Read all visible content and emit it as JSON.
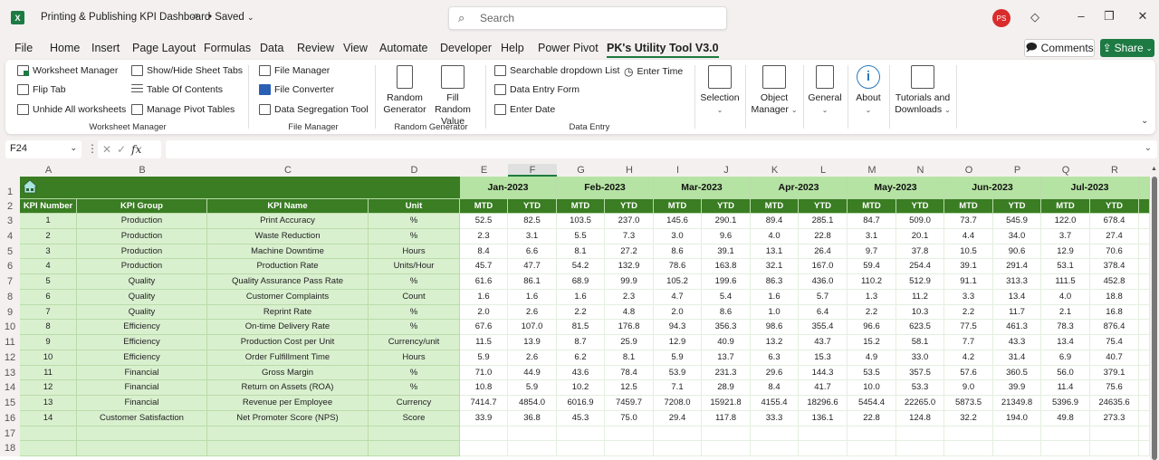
{
  "titlebar": {
    "app_icon": "excel-icon",
    "app_icon_letter": "X",
    "document_title": "Printing & Publishing KPI Dashboard",
    "save_status": "• Saved",
    "search_placeholder": "Search",
    "user_initials": "PS",
    "user_avatar_color": "#d92d2d"
  },
  "menu": {
    "tabs": [
      "File",
      "Home",
      "Insert",
      "Page Layout",
      "Formulas",
      "Data",
      "Review",
      "View",
      "Automate",
      "Developer",
      "Help",
      "Power Pivot",
      "PK's Utility Tool V3.0"
    ],
    "active_tab": "PK's Utility Tool V3.0",
    "comments_label": "Comments",
    "share_label": "Share",
    "share_color": "#1d7a43"
  },
  "ribbon": {
    "worksheet_manager": {
      "label": "Worksheet Manager",
      "items": [
        "Worksheet Manager",
        "Flip Tab",
        "Unhide All worksheets",
        "Show/Hide Sheet Tabs",
        "Table Of Contents",
        "Manage Pivot Tables"
      ]
    },
    "file_manager": {
      "label": "File Manager",
      "items": [
        "File Manager",
        "File Converter",
        "Data Segregation Tool"
      ]
    },
    "random_generator": {
      "label": "Random Generator",
      "items": [
        {
          "line1": "Random",
          "line2": "Generator"
        },
        {
          "line1": "Fill Random",
          "line2": "Value"
        }
      ]
    },
    "data_entry": {
      "label": "Data Entry",
      "items": [
        "Searchable dropdown List",
        "Data Entry Form",
        "Enter Date",
        "Enter Time"
      ]
    },
    "selection": {
      "line1": "Selection",
      "line2": ""
    },
    "object_manager": {
      "line1": "Object",
      "line2": "Manager"
    },
    "general": {
      "line1": "General",
      "line2": ""
    },
    "about": {
      "line1": "About",
      "line2": ""
    },
    "tutorials": {
      "line1": "Tutorials and",
      "line2": "Downloads"
    }
  },
  "formula_bar": {
    "name_box": "F24",
    "fx_label": "fx",
    "formula": ""
  },
  "sheet": {
    "selected_column": "F",
    "columns": [
      "A",
      "B",
      "C",
      "D",
      "E",
      "F",
      "G",
      "H",
      "I",
      "J",
      "K",
      "L",
      "M",
      "N",
      "O",
      "P",
      "Q",
      "R"
    ],
    "row_numbers": [
      "1",
      "2",
      "3",
      "4",
      "5",
      "6",
      "7",
      "8",
      "9",
      "10",
      "11",
      "12",
      "13",
      "14",
      "15",
      "16",
      "17",
      "18"
    ],
    "header_color": "#3a7d23",
    "month_band_color": "#b5e3a3",
    "left_body_color": "#d9f0cf",
    "headers": [
      "KPI Number",
      "KPI Group",
      "KPI Name",
      "Unit"
    ],
    "months": [
      "Jan-2023",
      "Feb-2023",
      "Mar-2023",
      "Apr-2023",
      "May-2023",
      "Jun-2023",
      "Jul-2023"
    ],
    "sub_headers": [
      "MTD",
      "YTD"
    ],
    "rows": [
      {
        "num": "1",
        "group": "Production",
        "name": "Print Accuracy",
        "unit": "%",
        "values": [
          "52.5",
          "82.5",
          "103.5",
          "237.0",
          "145.6",
          "290.1",
          "89.4",
          "285.1",
          "84.7",
          "509.0",
          "73.7",
          "545.9",
          "122.0",
          "678.4"
        ]
      },
      {
        "num": "2",
        "group": "Production",
        "name": "Waste Reduction",
        "unit": "%",
        "values": [
          "2.3",
          "3.1",
          "5.5",
          "7.3",
          "3.0",
          "9.6",
          "4.0",
          "22.8",
          "3.1",
          "20.1",
          "4.4",
          "34.0",
          "3.7",
          "27.4"
        ]
      },
      {
        "num": "3",
        "group": "Production",
        "name": "Machine Downtime",
        "unit": "Hours",
        "values": [
          "8.4",
          "6.6",
          "8.1",
          "27.2",
          "8.6",
          "39.1",
          "13.1",
          "26.4",
          "9.7",
          "37.8",
          "10.5",
          "90.6",
          "12.9",
          "70.6"
        ]
      },
      {
        "num": "4",
        "group": "Production",
        "name": "Production Rate",
        "unit": "Units/Hour",
        "values": [
          "45.7",
          "47.7",
          "54.2",
          "132.9",
          "78.6",
          "163.8",
          "32.1",
          "167.0",
          "59.4",
          "254.4",
          "39.1",
          "291.4",
          "53.1",
          "378.4"
        ]
      },
      {
        "num": "5",
        "group": "Quality",
        "name": "Quality Assurance Pass Rate",
        "unit": "%",
        "values": [
          "61.6",
          "86.1",
          "68.9",
          "99.9",
          "105.2",
          "199.6",
          "86.3",
          "436.0",
          "110.2",
          "512.9",
          "91.1",
          "313.3",
          "111.5",
          "452.8"
        ]
      },
      {
        "num": "6",
        "group": "Quality",
        "name": "Customer Complaints",
        "unit": "Count",
        "values": [
          "1.6",
          "1.6",
          "1.6",
          "2.3",
          "4.7",
          "5.4",
          "1.6",
          "5.7",
          "1.3",
          "11.2",
          "3.3",
          "13.4",
          "4.0",
          "18.8"
        ]
      },
      {
        "num": "7",
        "group": "Quality",
        "name": "Reprint Rate",
        "unit": "%",
        "values": [
          "2.0",
          "2.6",
          "2.2",
          "4.8",
          "2.0",
          "8.6",
          "1.0",
          "6.4",
          "2.2",
          "10.3",
          "2.2",
          "11.7",
          "2.1",
          "16.8"
        ]
      },
      {
        "num": "8",
        "group": "Efficiency",
        "name": "On-time Delivery Rate",
        "unit": "%",
        "values": [
          "67.6",
          "107.0",
          "81.5",
          "176.8",
          "94.3",
          "356.3",
          "98.6",
          "355.4",
          "96.6",
          "623.5",
          "77.5",
          "461.3",
          "78.3",
          "876.4"
        ]
      },
      {
        "num": "9",
        "group": "Efficiency",
        "name": "Production Cost per Unit",
        "unit": "Currency/unit",
        "values": [
          "11.5",
          "13.9",
          "8.7",
          "25.9",
          "12.9",
          "40.9",
          "13.2",
          "43.7",
          "15.2",
          "58.1",
          "7.7",
          "43.3",
          "13.4",
          "75.4"
        ]
      },
      {
        "num": "10",
        "group": "Efficiency",
        "name": "Order Fulfillment Time",
        "unit": "Hours",
        "values": [
          "5.9",
          "2.6",
          "6.2",
          "8.1",
          "5.9",
          "13.7",
          "6.3",
          "15.3",
          "4.9",
          "33.0",
          "4.2",
          "31.4",
          "6.9",
          "40.7"
        ]
      },
      {
        "num": "11",
        "group": "Financial",
        "name": "Gross Margin",
        "unit": "%",
        "values": [
          "71.0",
          "44.9",
          "43.6",
          "78.4",
          "53.9",
          "231.3",
          "29.6",
          "144.3",
          "53.5",
          "357.5",
          "57.6",
          "360.5",
          "56.0",
          "379.1"
        ]
      },
      {
        "num": "12",
        "group": "Financial",
        "name": "Return on Assets (ROA)",
        "unit": "%",
        "values": [
          "10.8",
          "5.9",
          "10.2",
          "12.5",
          "7.1",
          "28.9",
          "8.4",
          "41.7",
          "10.0",
          "53.3",
          "9.0",
          "39.9",
          "11.4",
          "75.6"
        ]
      },
      {
        "num": "13",
        "group": "Financial",
        "name": "Revenue per Employee",
        "unit": "Currency",
        "values": [
          "7414.7",
          "4854.0",
          "6016.9",
          "7459.7",
          "7208.0",
          "15921.8",
          "4155.4",
          "18296.6",
          "5454.4",
          "22265.0",
          "5873.5",
          "21349.8",
          "5396.9",
          "24635.6"
        ]
      },
      {
        "num": "14",
        "group": "Customer Satisfaction",
        "name": "Net Promoter Score (NPS)",
        "unit": "Score",
        "values": [
          "33.9",
          "36.8",
          "45.3",
          "75.0",
          "29.4",
          "117.8",
          "33.3",
          "136.1",
          "22.8",
          "124.8",
          "32.2",
          "194.0",
          "49.8",
          "273.3"
        ]
      },
      {
        "num": "",
        "group": "",
        "name": "",
        "unit": "",
        "values": [
          "",
          "",
          "",
          "",
          "",
          "",
          "",
          "",
          "",
          "",
          "",
          "",
          "",
          ""
        ]
      },
      {
        "num": "",
        "group": "",
        "name": "",
        "unit": "",
        "values": [
          "",
          "",
          "",
          "",
          "",
          "",
          "",
          "",
          "",
          "",
          "",
          "",
          "",
          ""
        ]
      }
    ]
  }
}
